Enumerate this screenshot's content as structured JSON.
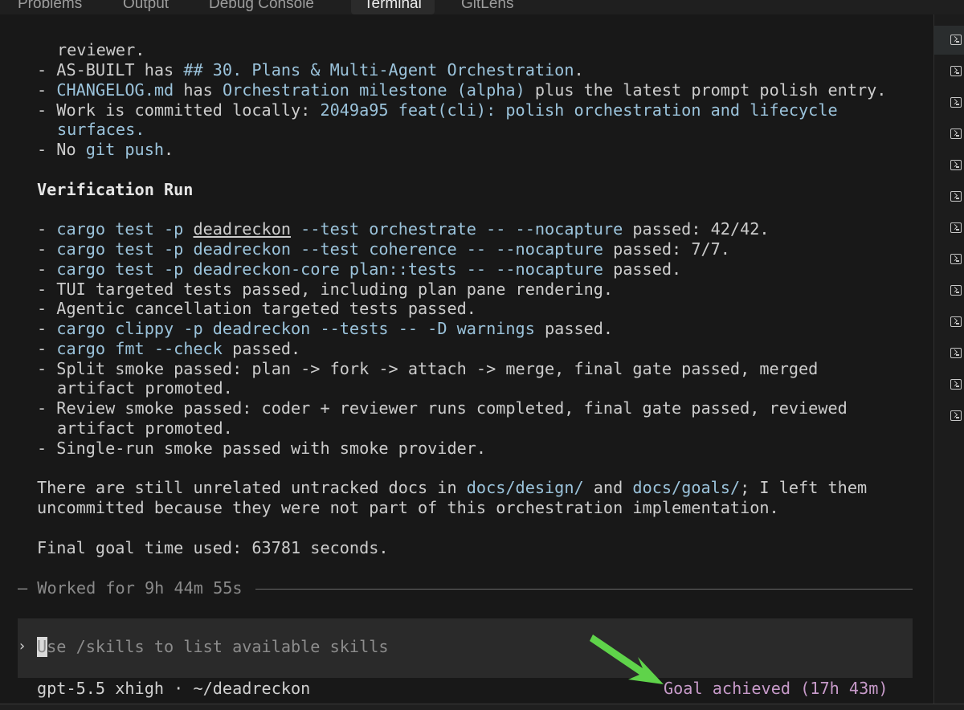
{
  "tabs": [
    {
      "label": "Problems",
      "active": false
    },
    {
      "label": "Output",
      "active": false
    },
    {
      "label": "Debug Console",
      "active": false
    },
    {
      "label": "Terminal",
      "active": true
    },
    {
      "label": "GitLens",
      "active": false
    }
  ],
  "terminal": {
    "line_01": "reviewer.",
    "line_02_a": "- AS-BUILT has ",
    "line_02_b": "## 30. Plans & Multi-Agent Orchestration",
    "line_02_c": ".",
    "line_03_a": "- ",
    "line_03_b": "CHANGELOG.md",
    "line_03_c": " has ",
    "line_03_d": "Orchestration milestone (alpha)",
    "line_03_e": " plus the latest prompt polish entry.",
    "line_04_a": "- Work is committed locally: ",
    "line_04_b": "2049a95 feat(cli): polish orchestration and lifecycle",
    "line_05": "surfaces.",
    "line_06_a": "- No ",
    "line_06_b": "git push",
    "line_06_c": ".",
    "heading": "Verification Run",
    "v1_a": "- ",
    "v1_b": "cargo test -p ",
    "v1_c": "deadreckon",
    "v1_d": " --test orchestrate -- --nocapture",
    "v1_e": " passed: 42/42.",
    "v2_a": "- ",
    "v2_b": "cargo test -p deadreckon --test coherence -- --nocapture",
    "v2_c": " passed: 7/7.",
    "v3_a": "- ",
    "v3_b": "cargo test -p deadreckon-core plan::tests -- --nocapture",
    "v3_c": " passed.",
    "v4": "- TUI targeted tests passed, including plan pane rendering.",
    "v5": "- Agentic cancellation targeted tests passed.",
    "v6_a": "- ",
    "v6_b": "cargo clippy -p deadreckon --tests -- -D warnings",
    "v6_c": " passed.",
    "v7_a": "- ",
    "v7_b": "cargo fmt --check",
    "v7_c": " passed.",
    "v8": "- Split smoke passed: plan -> fork -> attach -> merge, final gate passed, merged",
    "v8_cont": "artifact promoted.",
    "v9": "- Review smoke passed: coder + reviewer runs completed, final gate passed, reviewed",
    "v9_cont": "artifact promoted.",
    "v10": "- Single-run smoke passed with smoke provider.",
    "p1_a": "There are still unrelated untracked docs in ",
    "p1_b": "docs/design/",
    "p1_c": " and ",
    "p1_d": "docs/goals/",
    "p1_e": "; I left them",
    "p2": "uncommitted because they were not part of this orchestration implementation.",
    "p3": "Final goal time used: 63781 seconds.",
    "worked": "— Worked for 9h 44m 55s"
  },
  "composer": {
    "prompt_glyph": "›",
    "placeholder": "Use /skills to list available skills"
  },
  "status": {
    "model": "gpt-5.5 xhigh · ~/deadreckon",
    "goal": "Goal achieved (17h 43m)"
  },
  "colors": {
    "background": "#181818",
    "code": "#9bc3db",
    "goal": "#c79ac9",
    "arrow": "#5fd34a"
  },
  "gutter": {
    "icon": "terminal-icon",
    "count": 13
  }
}
